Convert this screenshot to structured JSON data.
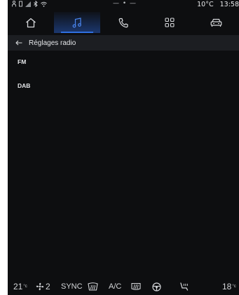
{
  "status": {
    "center": "— • —",
    "temperature": "10°C",
    "time": "13:58"
  },
  "nav": {
    "tabs": [
      {
        "icon": "home-icon"
      },
      {
        "icon": "music-note-icon",
        "active": true
      },
      {
        "icon": "phone-icon"
      },
      {
        "icon": "apps-grid-icon"
      },
      {
        "icon": "car-icon"
      }
    ]
  },
  "header": {
    "back_icon": "arrow-left-icon",
    "title": "Réglages radio"
  },
  "list": {
    "items": [
      "FM",
      "DAB"
    ]
  },
  "climate": {
    "left_temp": "21",
    "left_unit": "°c",
    "fan_level": "2",
    "sync_label": "SYNC",
    "ac_label": "A/C",
    "right_temp": "18",
    "right_unit": "°c"
  },
  "colors": {
    "background": "#0d0e10",
    "header_bg": "#1c1e22",
    "accent": "#2f6fe0"
  }
}
